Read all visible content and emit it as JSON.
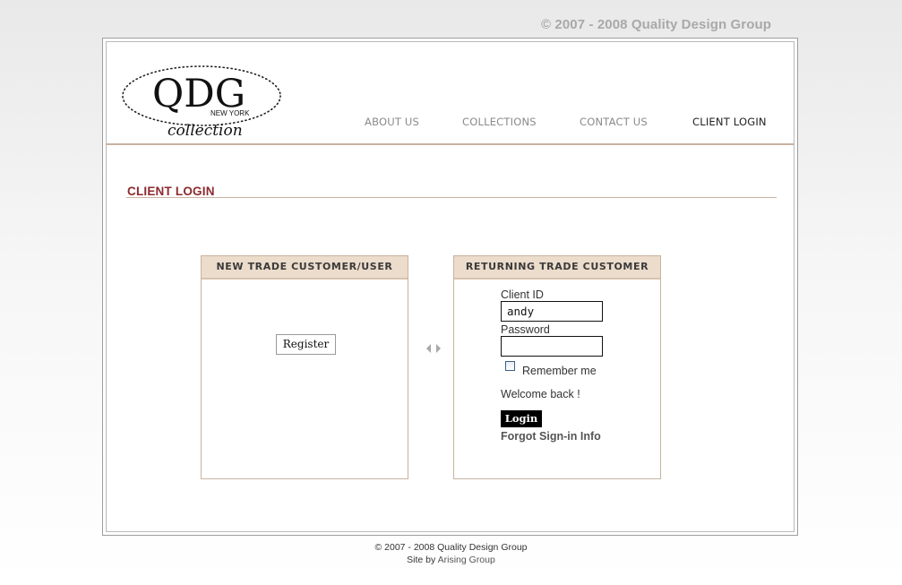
{
  "top_copyright": "© 2007 - 2008 Quality Design Group",
  "logo": {
    "mark": "QDG",
    "city": "NEW YORK",
    "script": "collection"
  },
  "nav": {
    "items": [
      "ABOUT US",
      "COLLECTIONS",
      "CONTACT US",
      "CLIENT LOGIN"
    ],
    "active": "CLIENT LOGIN"
  },
  "page_title": "CLIENT LOGIN",
  "new_customer": {
    "heading": "NEW TRADE CUSTOMER/USER",
    "register_label": "Register"
  },
  "returning_customer": {
    "heading": "RETURNING TRADE CUSTOMER",
    "client_id_label": "Client ID",
    "client_id_value": "andy",
    "password_label": "Password",
    "password_value": "",
    "remember_label": "Remember me",
    "remember_checked": false,
    "welcome_text": "Welcome back !",
    "login_label": "Login",
    "forgot_label": "Forgot Sign-in Info"
  },
  "footer": {
    "copyright": "© 2007 - 2008 Quality Design Group",
    "site_by_prefix": "Site by",
    "site_by_link": "Arising Group"
  },
  "colors": {
    "accent": "#8c2a2e",
    "panel_header": "#ecdccb",
    "rule": "#c7b2a1"
  },
  "icons": [
    "left-arrow-icon",
    "right-arrow-icon",
    "checkbox-icon"
  ]
}
